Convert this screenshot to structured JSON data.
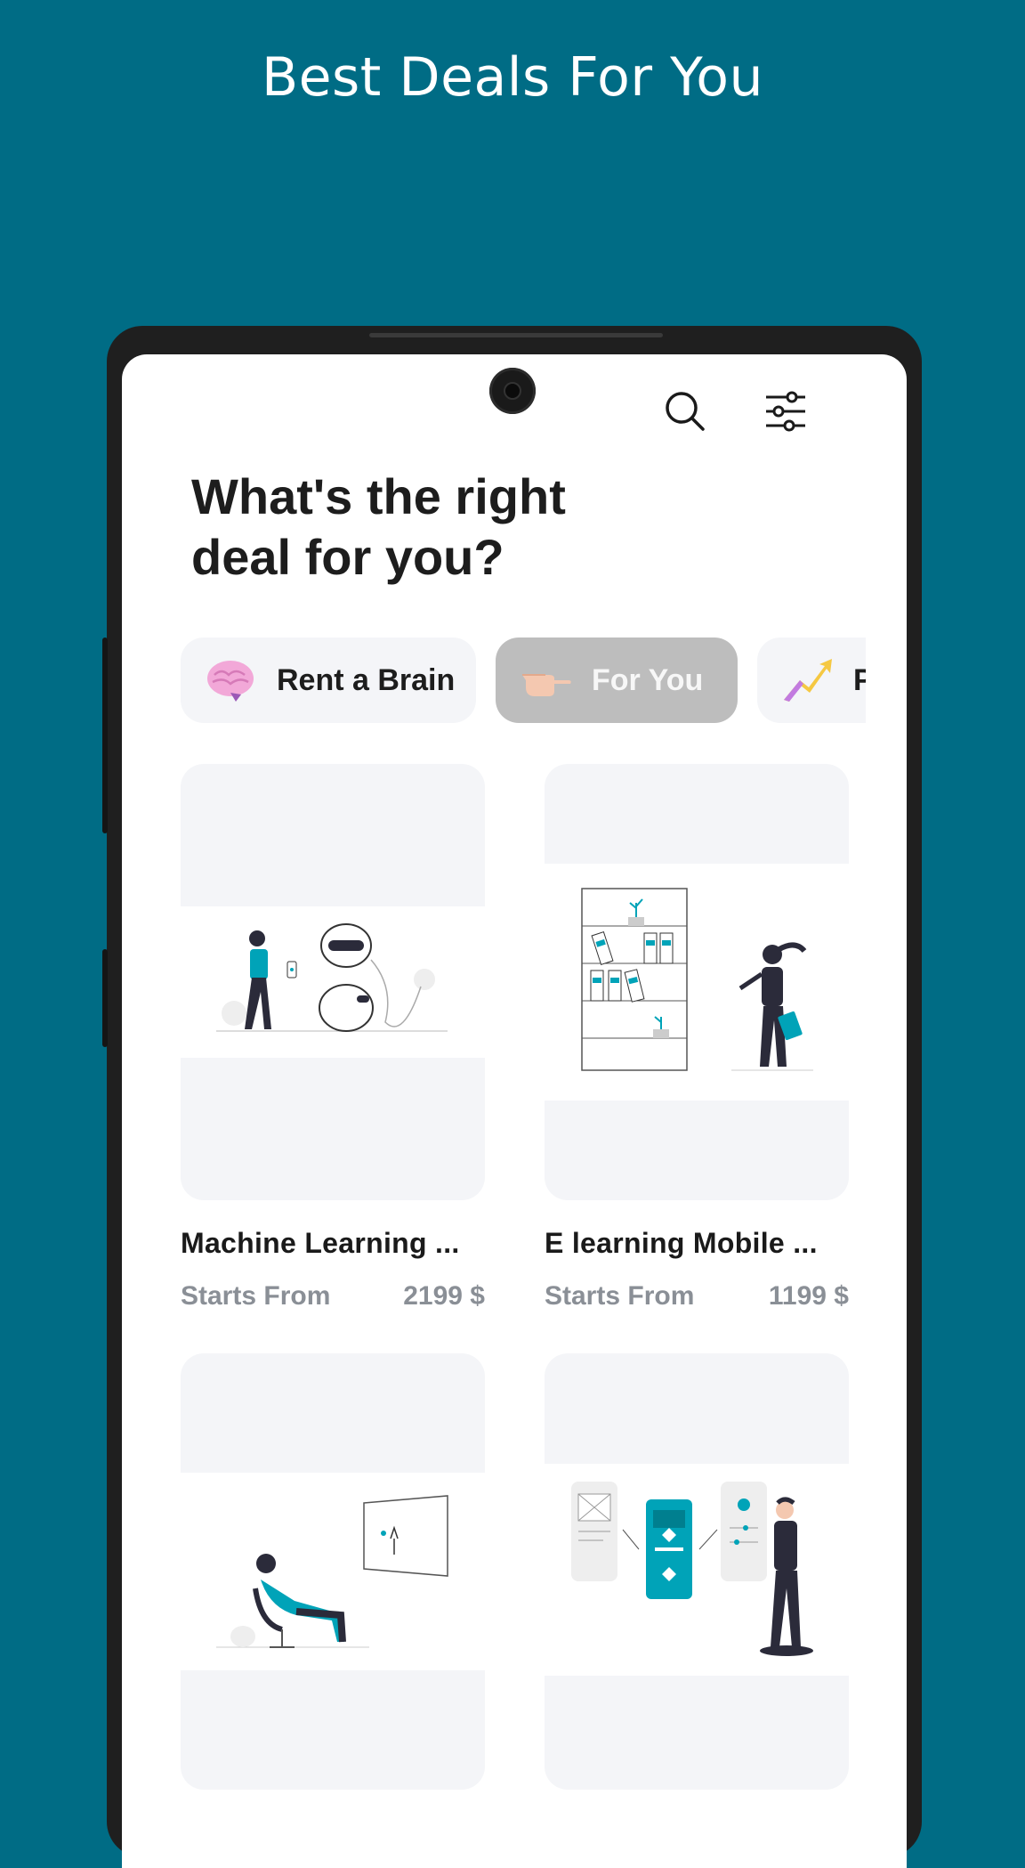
{
  "promo": {
    "title": "Best Deals For You"
  },
  "app": {
    "heading": "What's the right deal for you?",
    "icons": {
      "search": "search-icon",
      "filter": "sliders-icon"
    },
    "chips": [
      {
        "label": "Rent a Brain",
        "icon": "brain-emoji"
      },
      {
        "label": "For You",
        "icon": "pointing-hand-emoji",
        "active": true
      },
      {
        "label": "P",
        "icon": "chart-up-emoji"
      }
    ],
    "cards": [
      {
        "title": "Machine Learning ...",
        "starts_label": "Starts From",
        "price": "2199 $",
        "illustration": "robot-illustration"
      },
      {
        "title": "E learning Mobile ...",
        "starts_label": "Starts From",
        "price": "1199 $",
        "illustration": "bookshelf-illustration"
      },
      {
        "title": "",
        "starts_label": "",
        "price": "",
        "illustration": "presentation-illustration"
      },
      {
        "title": "",
        "starts_label": "",
        "price": "",
        "illustration": "mobile-wireframe-illustration"
      }
    ],
    "colors": {
      "background": "#006c85",
      "accent": "#00a3b8",
      "chip_active": "#bdbdbd",
      "card_bg": "#f4f5f8"
    }
  }
}
